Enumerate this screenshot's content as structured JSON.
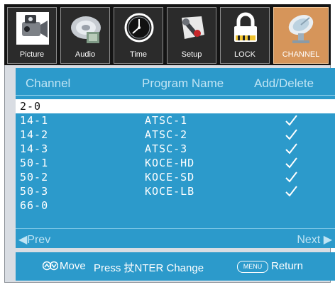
{
  "tabs": [
    {
      "label": "Picture",
      "icon": "camcorder-icon",
      "active": false
    },
    {
      "label": "Audio",
      "icon": "speaker-icon",
      "active": false
    },
    {
      "label": "Time",
      "icon": "clock-icon",
      "active": false
    },
    {
      "label": "Setup",
      "icon": "wrench-icon",
      "active": false
    },
    {
      "label": "LOCK",
      "icon": "padlock-icon",
      "active": false
    },
    {
      "label": "CHANNEL",
      "icon": "satellite-dish-icon",
      "active": true
    }
  ],
  "table": {
    "headers": [
      "Channel",
      "Program Name",
      "Add/Delete"
    ],
    "rows": [
      {
        "channel": "2-0",
        "program": "",
        "added": false,
        "selected": true
      },
      {
        "channel": "14-1",
        "program": "ATSC-1",
        "added": true,
        "selected": false
      },
      {
        "channel": "14-2",
        "program": "ATSC-2",
        "added": true,
        "selected": false
      },
      {
        "channel": "14-3",
        "program": "ATSC-3",
        "added": true,
        "selected": false
      },
      {
        "channel": "50-1",
        "program": "KOCE-HD",
        "added": true,
        "selected": false
      },
      {
        "channel": "50-2",
        "program": "KOCE-SD",
        "added": true,
        "selected": false
      },
      {
        "channel": "50-3",
        "program": "KOCE-LB",
        "added": true,
        "selected": false
      },
      {
        "channel": "66-0",
        "program": "",
        "added": false,
        "selected": false
      }
    ]
  },
  "nav": {
    "prev": "◀Prev",
    "next": "Next ▶"
  },
  "status": {
    "move": "Move",
    "press": "Press 扙NTER Change",
    "menu_key": "MENU",
    "return": "Return"
  },
  "colors": {
    "panel": "#2c9acb",
    "tab_bar": "#141414",
    "active_tab": "#d6955a"
  }
}
